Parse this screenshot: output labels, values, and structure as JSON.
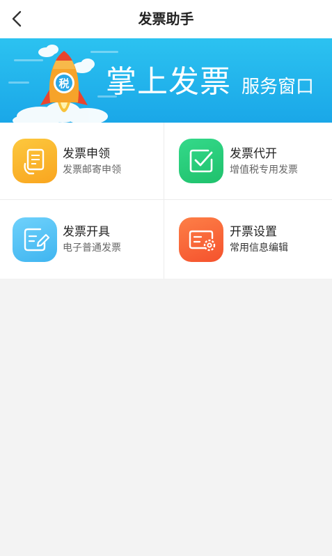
{
  "header": {
    "title": "发票助手",
    "back_icon": "chevron-left-icon"
  },
  "banner": {
    "title": "掌上发票",
    "subtitle": "服务窗口",
    "rocket_badge": "税",
    "colors": {
      "sky": "#1fb0ec",
      "rocket": "#f4a428",
      "flame": "#f05a3c"
    }
  },
  "services": [
    {
      "title": "发票申领",
      "subtitle": "发票邮寄申领",
      "icon": "invoice-apply-icon",
      "color": "#fbb62b"
    },
    {
      "title": "发票代开",
      "subtitle": "增值税专用发票",
      "icon": "checkbox-icon",
      "color": "#28cf78"
    },
    {
      "title": "发票开具",
      "subtitle": "电子普通发票",
      "icon": "edit-document-icon",
      "color": "#4fc3f7"
    },
    {
      "title": "开票设置",
      "subtitle": "常用信息编辑",
      "icon": "settings-card-icon",
      "color": "#fa6a3a"
    }
  ]
}
